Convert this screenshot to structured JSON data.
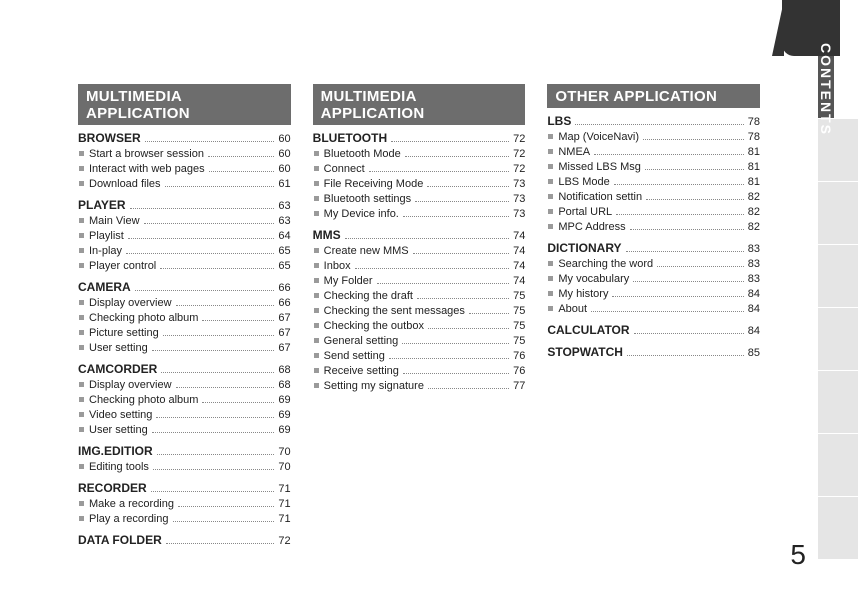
{
  "sideTabLabel": "CONTENTS",
  "pageNumber": "5",
  "columns": [
    {
      "header": "MULTIMEDIA APPLICATION",
      "groups": [
        {
          "heading": {
            "label": "BROWSER",
            "page": "60"
          },
          "items": [
            {
              "label": "Start a browser session",
              "page": "60"
            },
            {
              "label": "Interact with web pages",
              "page": "60"
            },
            {
              "label": "Download files",
              "page": "61"
            }
          ]
        },
        {
          "heading": {
            "label": "PLAYER",
            "page": "63"
          },
          "items": [
            {
              "label": "Main View",
              "page": "63"
            },
            {
              "label": "Playlist",
              "page": "64"
            },
            {
              "label": "In-play",
              "page": "65"
            },
            {
              "label": "Player control",
              "page": "65"
            }
          ]
        },
        {
          "heading": {
            "label": "CAMERA",
            "page": "66"
          },
          "items": [
            {
              "label": "Display overview",
              "page": "66"
            },
            {
              "label": "Checking photo album",
              "page": "67"
            },
            {
              "label": "Picture setting",
              "page": "67"
            },
            {
              "label": "User setting",
              "page": "67"
            }
          ]
        },
        {
          "heading": {
            "label": "CAMCORDER",
            "page": "68"
          },
          "items": [
            {
              "label": "Display overview",
              "page": "68"
            },
            {
              "label": "Checking photo album",
              "page": "69"
            },
            {
              "label": "Video setting",
              "page": "69"
            },
            {
              "label": "User setting",
              "page": "69"
            }
          ]
        },
        {
          "heading": {
            "label": "IMG.EDITIOR",
            "page": "70"
          },
          "items": [
            {
              "label": "Editing tools",
              "page": "70"
            }
          ]
        },
        {
          "heading": {
            "label": "RECORDER",
            "page": "71"
          },
          "items": [
            {
              "label": "Make a recording",
              "page": "71"
            },
            {
              "label": "Play a recording",
              "page": "71"
            }
          ]
        },
        {
          "heading": {
            "label": "DATA FOLDER",
            "page": "72"
          },
          "items": []
        }
      ]
    },
    {
      "header": "MULTIMEDIA APPLICATION",
      "groups": [
        {
          "heading": {
            "label": "BLUETOOTH",
            "page": "72"
          },
          "items": [
            {
              "label": "Bluetooth Mode",
              "page": "72"
            },
            {
              "label": "Connect",
              "page": "72"
            },
            {
              "label": "File Receiving Mode",
              "page": "73"
            },
            {
              "label": "Bluetooth settings",
              "page": "73"
            },
            {
              "label": "My Device info.",
              "page": "73"
            }
          ]
        },
        {
          "heading": {
            "label": "MMS",
            "page": "74"
          },
          "items": [
            {
              "label": "Create new MMS",
              "page": "74"
            },
            {
              "label": "Inbox",
              "page": "74"
            },
            {
              "label": "My Folder",
              "page": "74"
            },
            {
              "label": "Checking the draft",
              "page": "75"
            },
            {
              "label": "Checking the sent messages",
              "page": "75"
            },
            {
              "label": "Checking the outbox",
              "page": "75"
            },
            {
              "label": "General setting",
              "page": "75"
            },
            {
              "label": "Send setting",
              "page": "76"
            },
            {
              "label": "Receive setting",
              "page": "76"
            },
            {
              "label": "Setting my signature",
              "page": "77"
            }
          ]
        }
      ]
    },
    {
      "header": "OTHER APPLICATION",
      "groups": [
        {
          "heading": {
            "label": "LBS",
            "page": "78"
          },
          "items": [
            {
              "label": "Map (VoiceNavi)",
              "page": "78"
            },
            {
              "label": "NMEA",
              "page": "81"
            },
            {
              "label": "Missed LBS Msg",
              "page": "81"
            },
            {
              "label": "LBS Mode",
              "page": "81"
            },
            {
              "label": "Notification settin",
              "page": "82"
            },
            {
              "label": "Portal URL",
              "page": "82"
            },
            {
              "label": "MPC Address",
              "page": "82"
            }
          ]
        },
        {
          "heading": {
            "label": "DICTIONARY",
            "page": "83"
          },
          "items": [
            {
              "label": "Searching the word",
              "page": "83"
            },
            {
              "label": "My vocabulary",
              "page": "83"
            },
            {
              "label": "My history",
              "page": "84"
            },
            {
              "label": "About",
              "page": "84"
            }
          ]
        },
        {
          "heading": {
            "label": "CALCULATOR",
            "page": "84"
          },
          "items": []
        },
        {
          "heading": {
            "label": "STOPWATCH",
            "page": "85"
          },
          "items": []
        }
      ]
    }
  ]
}
